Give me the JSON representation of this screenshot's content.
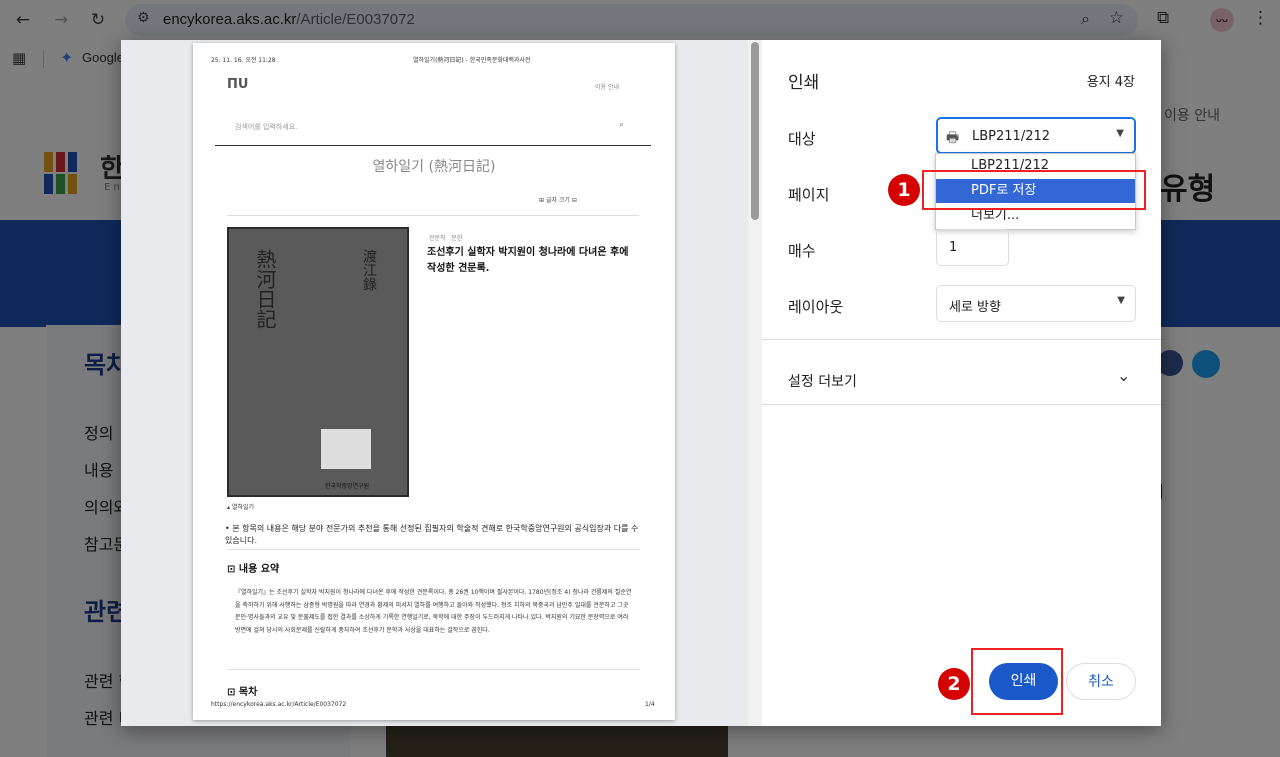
{
  "browser": {
    "url_host": "encykorea.aks.ac.kr",
    "url_path": "/Article/E0037072",
    "bookmark": "Google"
  },
  "site": {
    "header_guide": "이용 안내",
    "brand_fragment": "한",
    "brand_en_fragment": "En",
    "type_fragment": "유형",
    "toc_title": "목차",
    "toc_items": [
      "정의",
      "내용",
      "의의와",
      "참고문"
    ],
    "related_title": "관련",
    "related_items": [
      "관련 항",
      "관련 디"
    ],
    "right_fragment": "I"
  },
  "preview": {
    "header_datetime": "25. 11. 16. 오전 11:28",
    "header_title": "열하일기(熱河日記) - 한국민족문화대백과사전",
    "nav_guide": "이용 안내",
    "search_placeholder": "검색어를 입력하세요.",
    "article_title": "열하일기 (熱河日記)",
    "font_size_label": "글자 크기",
    "tags": [
      "전문작",
      "문헌"
    ],
    "summary_heading": "조선후기 실학자 박지원이 청나라에 다녀온 후에 작성한 견문록.",
    "image_caption": "열하일기",
    "image_stamp": "한국학중앙연구원",
    "notice": "• 본 항목의 내용은 해당 분야 전문가의 추천을 통해 선정된 집필자의 학술적 견해로 한국학중앙연구원의 공식입장과 다를 수 있습니다.",
    "section1_title": "내용 요약",
    "section1_text": "『열하일기』는 조선후기 실학자 박지원이 청나라에 다녀온 후에 작성한 견문록이다. 총 26권 10책이며 필사본이다. 1780년(정조 4) 청나라 건륭제의 칠순연을 축하하기 위해 사행하는 삼종형 박명원을 따라 연경과 황제의 피서지 열하를 여행하고 돌아와 작성했다. 청조 치하의 북중국과 남만주 일대를 견문하고 그곳 문인·명사들과의 교유 및 문물제도를 접한 결과를 소상하게 기록한 연행일기로, 북학에 대한 주장이 두드러지게 나타나 있다. 박지원의 기묘한 문장력으로 여러 방면에 걸쳐 당시의 사회문제를 신랄하게 풍자하여 조선후기 문학과 사상을 대표하는 걸작으로 꼽힌다.",
    "section2_title": "목차",
    "footer_url": "https://encykorea.aks.ac.kr/Article/E0037072",
    "footer_page": "1/4"
  },
  "print": {
    "title": "인쇄",
    "sheets": "용지 4장",
    "destination_label": "대상",
    "destination_value": "LBP211/212",
    "dropdown_options": [
      "LBP211/212",
      "PDF로 저장",
      "더보기..."
    ],
    "pages_label": "페이지",
    "copies_label": "매수",
    "copies_value": "1",
    "layout_label": "레이아웃",
    "layout_value": "세로 방향",
    "more_settings": "설정 더보기",
    "print_button": "인쇄",
    "cancel_button": "취소"
  },
  "annotations": [
    "1",
    "2"
  ],
  "colors": {
    "accent": "#1a73e8",
    "print_button": "#1a57c9",
    "selected_option": "#3367d6",
    "annotation": "#d50000",
    "site_band": "#1f55b4"
  }
}
